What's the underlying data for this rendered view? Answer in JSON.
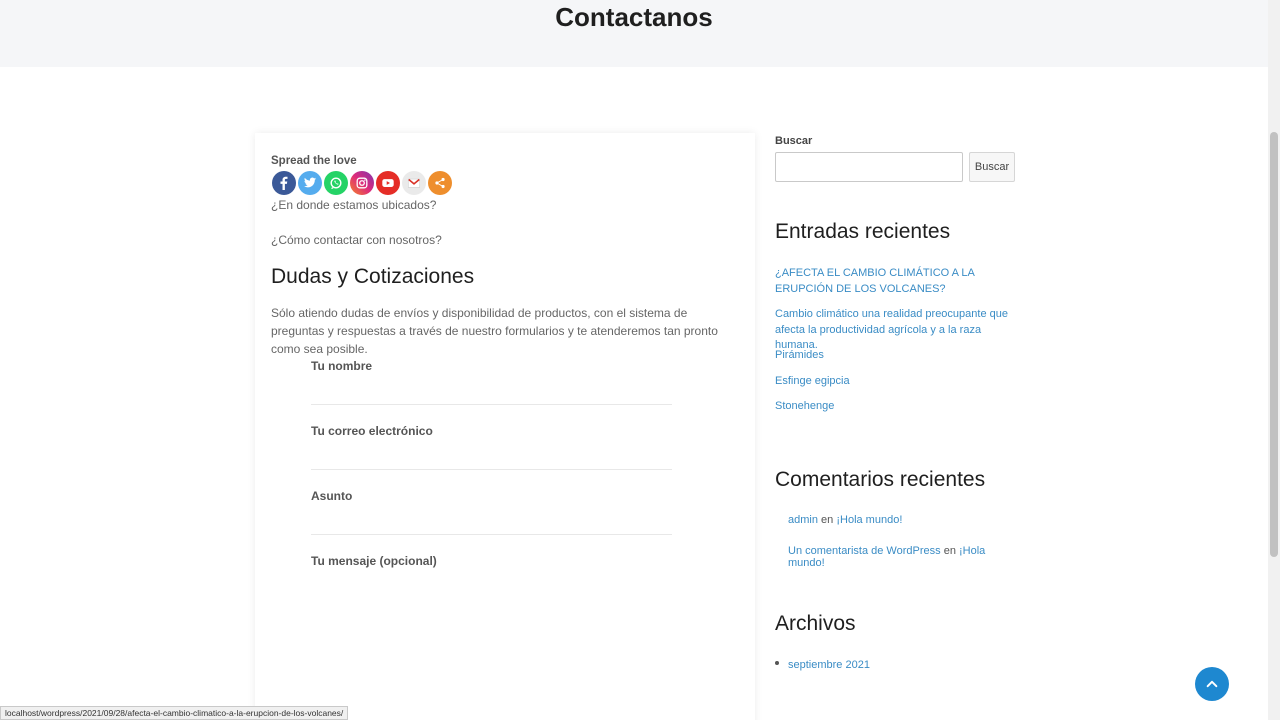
{
  "header": {
    "title": "Contactanos"
  },
  "share": {
    "title": "Spread the love",
    "icons": [
      "facebook-icon",
      "twitter-icon",
      "whatsapp-icon",
      "instagram-icon",
      "youtube-icon",
      "gmail-icon",
      "share-more-icon"
    ]
  },
  "content": {
    "q1": "¿En donde estamos ubicados?",
    "q2": "¿Cómo contactar con nosotros?",
    "heading": "Dudas y Cotizaciones",
    "description": "Sólo atiendo dudas de envíos y disponibilidad de productos, con el sistema de preguntas y respuestas a través de nuestro formularios y te atenderemos tan pronto como sea posible."
  },
  "form": {
    "name_label": "Tu nombre",
    "email_label": "Tu correo electrónico",
    "subject_label": "Asunto",
    "message_label": "Tu mensaje (opcional)"
  },
  "sidebar": {
    "search_label": "Buscar",
    "search_button": "Buscar",
    "recent_title": "Entradas recientes",
    "recent_posts": [
      "¿AFECTA EL CAMBIO CLIMÁTICO A LA ERUPCIÓN DE LOS VOLCANES?",
      "Cambio climático una realidad preocupante que afecta la productividad agrícola y a la raza humana.",
      "Pirámides",
      "Esfinge egipcia",
      "Stonehenge"
    ],
    "comments_title": "Comentarios recientes",
    "comments": [
      {
        "author": "admin",
        "sep": "en",
        "post": "¡Hola mundo!"
      },
      {
        "author": "Un comentarista de WordPress",
        "sep": "en",
        "post": "¡Hola mundo!"
      }
    ],
    "archives_title": "Archivos",
    "archives": [
      "septiembre 2021"
    ]
  },
  "status_bar": {
    "url": "localhost/wordpress/2021/09/28/afecta-el-cambio-climatico-a-la-erupcion-de-los-volcanes/"
  },
  "colors": {
    "accent": "#1e88d0",
    "link": "#3a8cc5"
  }
}
